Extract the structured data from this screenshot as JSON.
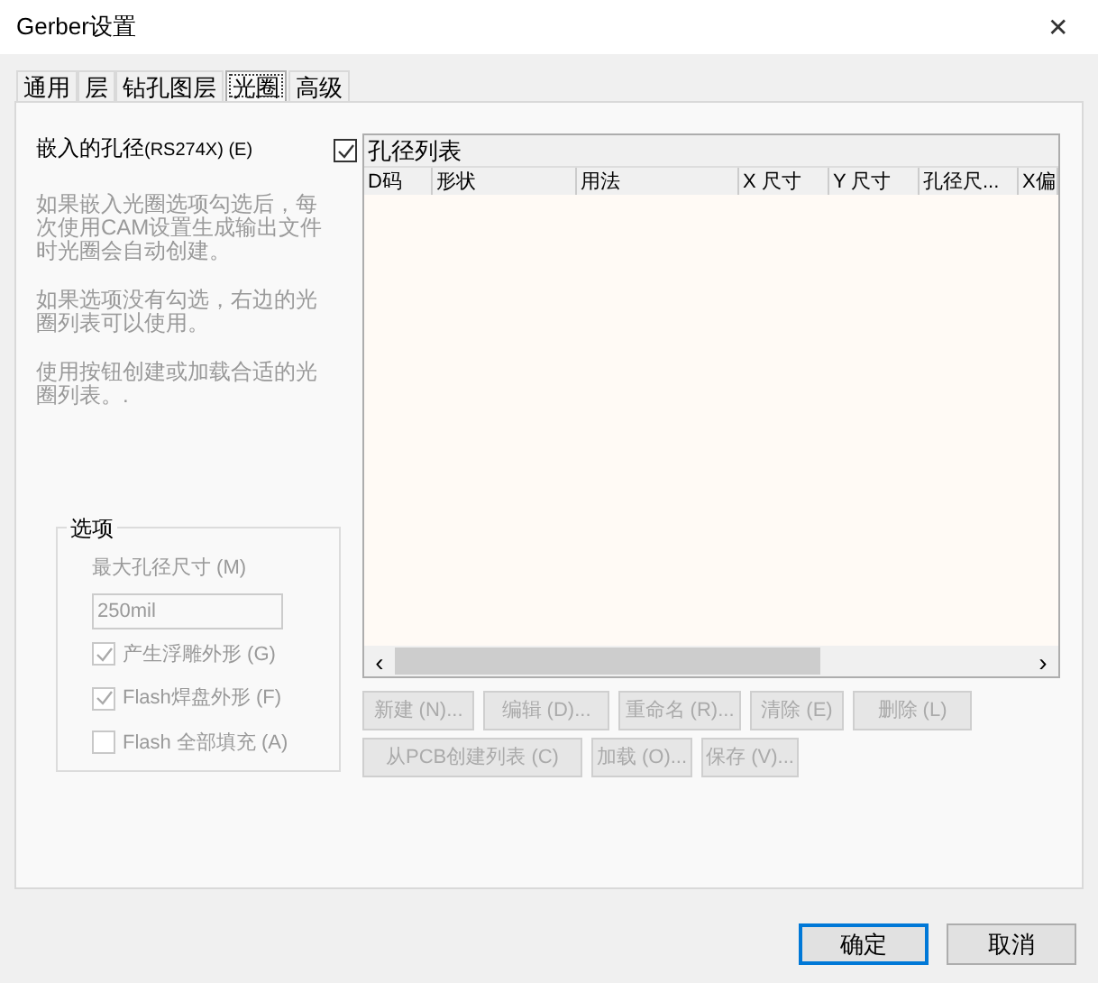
{
  "window": {
    "title": "Gerber设置",
    "close": "✕"
  },
  "tabs": [
    {
      "label": "通用",
      "selected": false
    },
    {
      "label": "层",
      "selected": false
    },
    {
      "label": "钻孔图层",
      "selected": false
    },
    {
      "label": "光圈",
      "selected": true
    },
    {
      "label": "高级",
      "selected": false
    }
  ],
  "embed": {
    "label": "嵌入的孔径",
    "code": "(RS274X)",
    "key": "(E)"
  },
  "help_paragraphs": [
    "如果嵌入光圈选项勾选后，每次使用CAM设置生成输出文件时光圈会自动创建。",
    "如果选项没有勾选，右边的光圈列表可以使用。",
    "使用按钮创建或加载合适的光圈列表。."
  ],
  "options": {
    "title": "选项",
    "max_label": "最大孔径尺寸 (M)",
    "max_value": "250mil",
    "checks": [
      {
        "label": "产生浮雕外形 (G)",
        "checked": true
      },
      {
        "label": "Flash焊盘外形 (F)",
        "checked": true
      },
      {
        "label": "Flash 全部填充 (A)",
        "checked": false
      }
    ]
  },
  "aperture_list": {
    "checked": true,
    "title": "孔径列表",
    "columns": [
      "D码",
      "形状",
      "用法",
      "X 尺寸",
      "Y 尺寸",
      "孔径尺...",
      "X偏"
    ],
    "scroll_left": "‹",
    "scroll_right": "›"
  },
  "list_buttons": [
    [
      "新建 (N)...",
      "编辑 (D)...",
      "重命名 (R)...",
      "清除 (E)",
      "删除 (L)"
    ],
    [
      "从PCB创建列表 (C)",
      "加载 (O)...",
      "保存 (V)..."
    ]
  ],
  "dialog_buttons": [
    {
      "label": "确定",
      "default": true
    },
    {
      "label": "取消",
      "default": false
    }
  ]
}
